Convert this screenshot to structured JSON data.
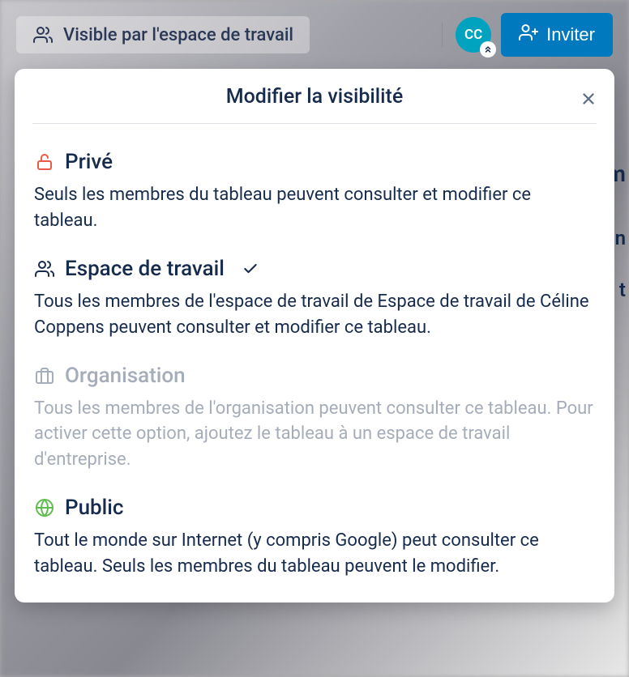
{
  "header": {
    "visibility_label": "Visible par l'espace de travail",
    "avatar_initials": "CC",
    "invite_label": "Inviter"
  },
  "modal": {
    "title": "Modifier la visibilité",
    "options": [
      {
        "key": "private",
        "icon": "lock-icon",
        "title": "Privé",
        "description": "Seuls les membres du tableau peuvent consulter et modifier ce tableau.",
        "selected": false,
        "disabled": false
      },
      {
        "key": "workspace",
        "icon": "people-icon",
        "title": "Espace de travail",
        "description": "Tous les membres de l'espace de travail de Espace de travail de Céline Coppens peuvent consulter et modifier ce tableau.",
        "selected": true,
        "disabled": false
      },
      {
        "key": "organization",
        "icon": "briefcase-icon",
        "title": "Organisation",
        "description": "Tous les membres de l'organisation peuvent consulter ce tableau. Pour activer cette option, ajoutez le tableau à un espace de travail d'entreprise.",
        "selected": false,
        "disabled": true
      },
      {
        "key": "public",
        "icon": "globe-icon",
        "title": "Public",
        "description": "Tout le monde sur Internet (y compris Google) peut consulter ce tableau. Seuls les membres du tableau peuvent le modifier.",
        "selected": false,
        "disabled": false
      }
    ]
  },
  "background_text_fragments": [
    "m",
    "on",
    "e t"
  ]
}
